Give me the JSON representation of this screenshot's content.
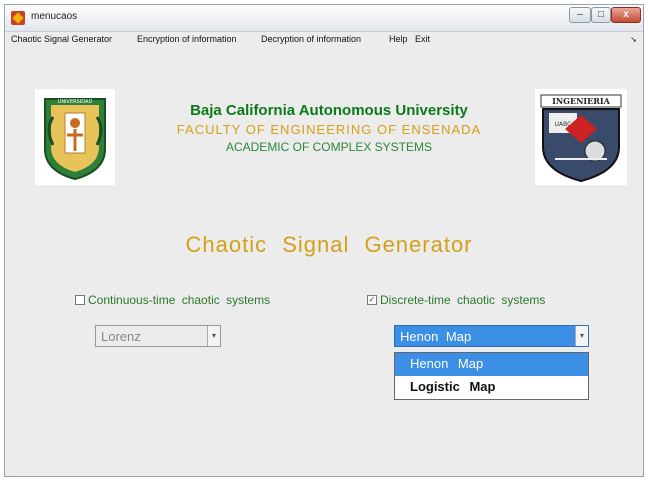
{
  "window": {
    "title": "menucaos",
    "minimize": "–",
    "maximize": "□",
    "close": "x"
  },
  "menubar": {
    "items": [
      {
        "label": "Chaotic Signal Generator"
      },
      {
        "label": "Encryption of information"
      },
      {
        "label": "Decryption of information"
      },
      {
        "label": "Help"
      },
      {
        "label": "Exit"
      }
    ],
    "overflow_icon": "arrow-icon"
  },
  "header": {
    "university": "Baja California Autonomous University",
    "faculty": "FACULTY OF ENGINEERING OF ENSENADA",
    "academic": "ACADEMIC OF COMPLEX SYSTEMS",
    "logo_right_text": "INGENIERIA",
    "logo_right_small": "UABC",
    "logo_left_text": "UNIVERSIDAD"
  },
  "main": {
    "title": "Chaotic Signal Generator",
    "continuous": {
      "label": "Continuous-time chaotic systems",
      "checked": false,
      "selected": "Lorenz"
    },
    "discrete": {
      "label": "Discrete-time chaotic systems",
      "checked": true,
      "selected": "Henon Map",
      "options": [
        "Henon Map",
        "Logistic Map"
      ]
    }
  },
  "colors": {
    "university": "#0a7a1a",
    "gold": "#d4a017",
    "academic": "#2a8a3a",
    "highlight": "#3b8fe4"
  }
}
